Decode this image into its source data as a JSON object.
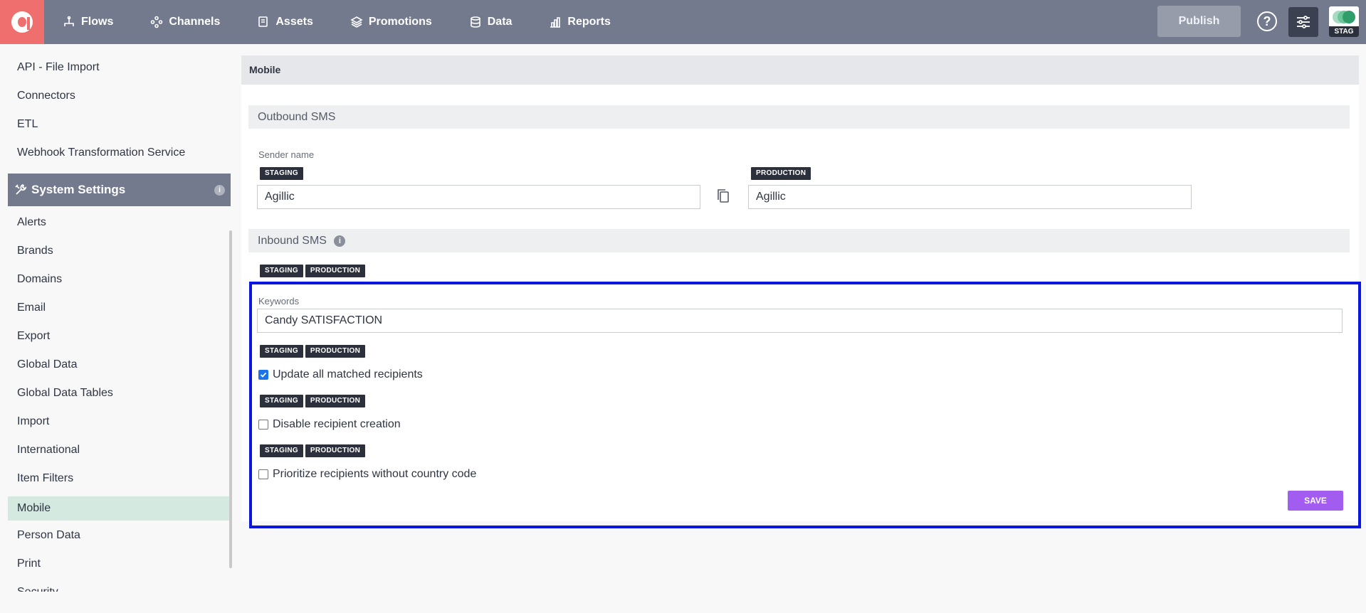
{
  "topbar": {
    "nav": [
      {
        "label": "Flows",
        "icon": "flows-icon"
      },
      {
        "label": "Channels",
        "icon": "channels-icon"
      },
      {
        "label": "Assets",
        "icon": "assets-icon"
      },
      {
        "label": "Promotions",
        "icon": "promotions-icon"
      },
      {
        "label": "Data",
        "icon": "data-icon"
      },
      {
        "label": "Reports",
        "icon": "reports-icon"
      }
    ],
    "publish_label": "Publish",
    "help_label": "?",
    "env_badge": "STAG",
    "colors": {
      "bar": "#737a8d",
      "logo": "#ee6f6d",
      "accent_purple": "#a35cf0",
      "active_green": "#d4e9df"
    }
  },
  "sidebar": {
    "top_items": [
      "API - File Import",
      "Connectors",
      "ETL",
      "Webhook Transformation Service"
    ],
    "section_title": "System Settings",
    "section_info": "i",
    "items": [
      "Alerts",
      "Brands",
      "Domains",
      "Email",
      "Export",
      "Global Data",
      "Global Data Tables",
      "Import",
      "International",
      "Item Filters",
      "Mobile",
      "Person Data",
      "Print",
      "Security"
    ],
    "active_item": "Mobile"
  },
  "main": {
    "title": "Mobile",
    "outbound": {
      "title": "Outbound SMS",
      "sender_label": "Sender name",
      "staging_tag": "STAGING",
      "production_tag": "PRODUCTION",
      "staging_value": "Agillic",
      "production_value": "Agillic"
    },
    "inbound": {
      "title": "Inbound SMS",
      "info": "i",
      "tags": [
        "STAGING",
        "PRODUCTION"
      ],
      "keywords_label": "Keywords",
      "keywords_value": "Candy SATISFACTION",
      "options": [
        {
          "label": "Update all matched recipients",
          "checked": true
        },
        {
          "label": "Disable recipient creation",
          "checked": false
        },
        {
          "label": "Prioritize recipients without country code",
          "checked": false
        }
      ],
      "save_label": "SAVE"
    }
  }
}
